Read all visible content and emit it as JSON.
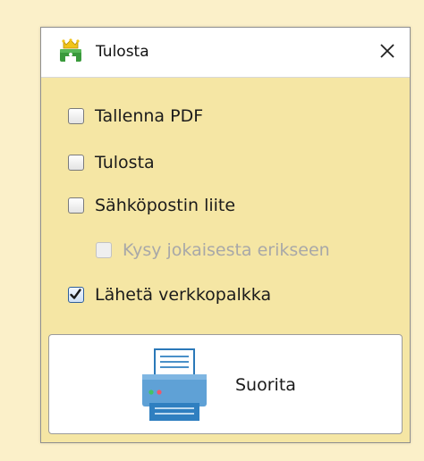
{
  "window": {
    "title": "Tulosta",
    "icon": "printer-crown-icon",
    "close_icon": "close-icon"
  },
  "options": [
    {
      "label": "Tallenna PDF",
      "checked": false,
      "disabled": false
    },
    {
      "label": "Tulosta",
      "checked": false,
      "disabled": false
    },
    {
      "label": "Sähköpostin liite",
      "checked": false,
      "disabled": false
    },
    {
      "label": "Kysy jokaisesta erikseen",
      "checked": false,
      "disabled": true
    },
    {
      "label": "Lähetä verkkopalkka",
      "checked": true,
      "disabled": false
    }
  ],
  "run_button": {
    "label": "Suorita",
    "icon": "printer-icon"
  },
  "colors": {
    "background": "#fbf0c9",
    "dialog": "#f5e6a4",
    "checked_border": "#2f5f9a"
  }
}
